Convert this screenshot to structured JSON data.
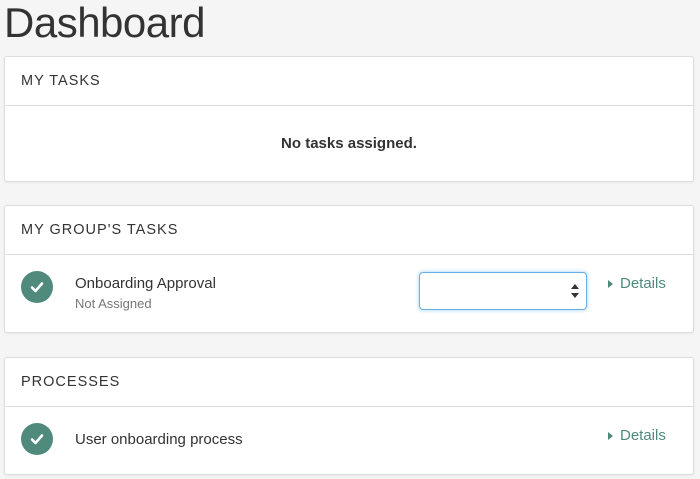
{
  "page": {
    "title": "Dashboard"
  },
  "my_tasks": {
    "heading": "MY TASKS",
    "empty_message": "No tasks assigned."
  },
  "group_tasks": {
    "heading": "MY GROUP'S TASKS",
    "items": [
      {
        "title": "Onboarding Approval",
        "subtitle": "Not Assigned",
        "assignee_select_value": "",
        "details_label": "Details",
        "status_icon": "check-circle-icon"
      }
    ]
  },
  "processes": {
    "heading": "PROCESSES",
    "items": [
      {
        "title": "User onboarding process",
        "details_label": "Details",
        "status_icon": "check-circle-icon"
      }
    ]
  },
  "colors": {
    "accent": "#4f8a7d",
    "background": "#f5f5f5",
    "panel_border": "#dddddd",
    "focus": "#66afe9"
  }
}
